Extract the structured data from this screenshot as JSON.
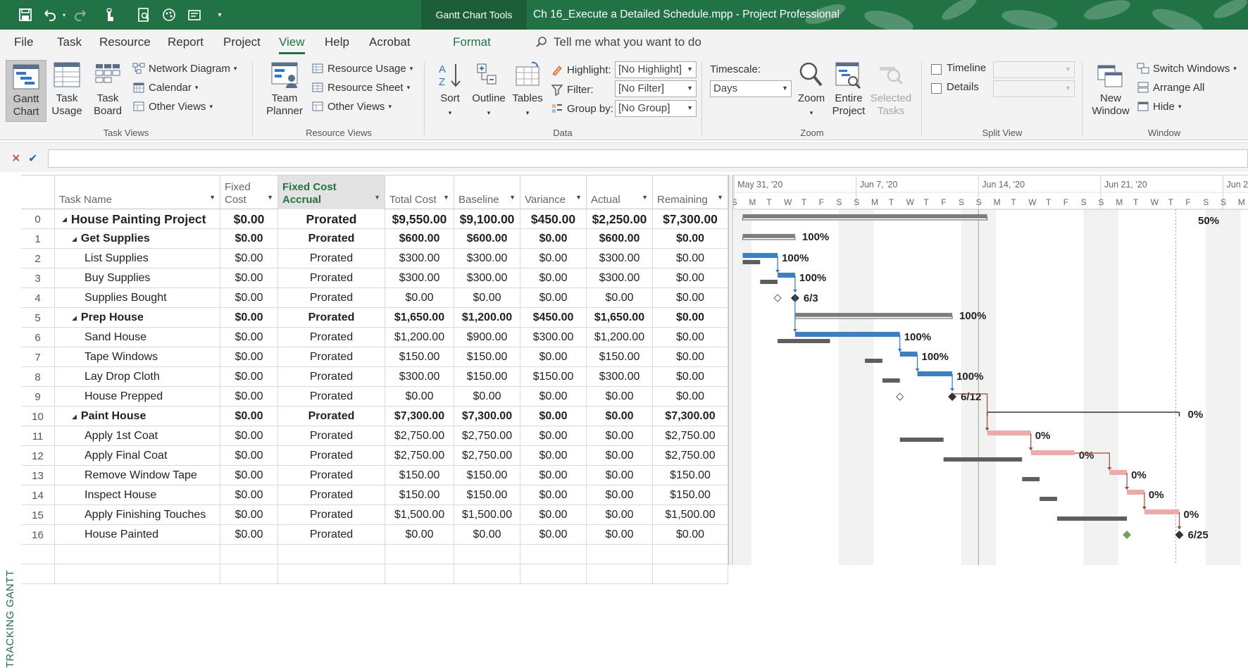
{
  "app": {
    "document_title": "Ch 16_Execute a Detailed Schedule.mpp  -  Project Professional",
    "contextual_tab_group": "Gantt Chart Tools"
  },
  "quick_access_icons": [
    "save-icon",
    "undo-icon",
    "redo-icon",
    "touch-mode-icon",
    "print-preview-icon",
    "format-painter-icon",
    "more-commands-icon",
    "customize-icon"
  ],
  "menu": {
    "items": [
      "File",
      "Task",
      "Resource",
      "Report",
      "Project",
      "View",
      "Help",
      "Acrobat"
    ],
    "active": "View",
    "format": "Format",
    "tell_me": "Tell me what you want to do"
  },
  "ribbon": {
    "task_views": {
      "group": "Task Views",
      "gantt_chart": "Gantt Chart",
      "task_usage": "Task Usage",
      "task_board": "Task Board",
      "network_diagram": "Network Diagram",
      "calendar": "Calendar",
      "other_views": "Other Views"
    },
    "resource_views": {
      "group": "Resource Views",
      "team_planner": "Team Planner",
      "resource_usage": "Resource Usage",
      "resource_sheet": "Resource Sheet",
      "other_views": "Other Views"
    },
    "data": {
      "group": "Data",
      "sort": "Sort",
      "outline": "Outline",
      "tables": "Tables",
      "highlight_label": "Highlight:",
      "highlight_value": "[No Highlight]",
      "filter_label": "Filter:",
      "filter_value": "[No Filter]",
      "group_by_label": "Group by:",
      "group_by_value": "[No Group]"
    },
    "zoom": {
      "group": "Zoom",
      "timescale_label": "Timescale:",
      "timescale_value": "Days",
      "zoom": "Zoom",
      "entire_project": "Entire Project",
      "selected_tasks": "Selected Tasks"
    },
    "split_view": {
      "group": "Split View",
      "timeline": "Timeline",
      "details": "Details"
    },
    "window": {
      "group": "Window",
      "new_window": "New Window",
      "switch_windows": "Switch Windows",
      "arrange_all": "Arrange All",
      "hide": "Hide"
    }
  },
  "view_label": "TRACKING GANTT",
  "table": {
    "columns": [
      "Task Name",
      "Fixed Cost",
      "Fixed Cost Accrual",
      "Total Cost",
      "Baseline",
      "Variance",
      "Actual",
      "Remaining"
    ],
    "rows": [
      {
        "id": "0",
        "name": "House Painting Project",
        "fixed": "$0.00",
        "accrual": "Prorated",
        "total": "$9,550.00",
        "baseline": "$9,100.00",
        "variance": "$450.00",
        "actual": "$2,250.00",
        "remaining": "$7,300.00"
      },
      {
        "id": "1",
        "name": "Get Supplies",
        "fixed": "$0.00",
        "accrual": "Prorated",
        "total": "$600.00",
        "baseline": "$600.00",
        "variance": "$0.00",
        "actual": "$600.00",
        "remaining": "$0.00"
      },
      {
        "id": "2",
        "name": "List Supplies",
        "fixed": "$0.00",
        "accrual": "Prorated",
        "total": "$300.00",
        "baseline": "$300.00",
        "variance": "$0.00",
        "actual": "$300.00",
        "remaining": "$0.00"
      },
      {
        "id": "3",
        "name": "Buy Supplies",
        "fixed": "$0.00",
        "accrual": "Prorated",
        "total": "$300.00",
        "baseline": "$300.00",
        "variance": "$0.00",
        "actual": "$300.00",
        "remaining": "$0.00"
      },
      {
        "id": "4",
        "name": "Supplies Bought",
        "fixed": "$0.00",
        "accrual": "Prorated",
        "total": "$0.00",
        "baseline": "$0.00",
        "variance": "$0.00",
        "actual": "$0.00",
        "remaining": "$0.00"
      },
      {
        "id": "5",
        "name": "Prep House",
        "fixed": "$0.00",
        "accrual": "Prorated",
        "total": "$1,650.00",
        "baseline": "$1,200.00",
        "variance": "$450.00",
        "actual": "$1,650.00",
        "remaining": "$0.00"
      },
      {
        "id": "6",
        "name": "Sand House",
        "fixed": "$0.00",
        "accrual": "Prorated",
        "total": "$1,200.00",
        "baseline": "$900.00",
        "variance": "$300.00",
        "actual": "$1,200.00",
        "remaining": "$0.00"
      },
      {
        "id": "7",
        "name": "Tape Windows",
        "fixed": "$0.00",
        "accrual": "Prorated",
        "total": "$150.00",
        "baseline": "$150.00",
        "variance": "$0.00",
        "actual": "$150.00",
        "remaining": "$0.00"
      },
      {
        "id": "8",
        "name": "Lay Drop Cloth",
        "fixed": "$0.00",
        "accrual": "Prorated",
        "total": "$300.00",
        "baseline": "$150.00",
        "variance": "$150.00",
        "actual": "$300.00",
        "remaining": "$0.00"
      },
      {
        "id": "9",
        "name": "House Prepped",
        "fixed": "$0.00",
        "accrual": "Prorated",
        "total": "$0.00",
        "baseline": "$0.00",
        "variance": "$0.00",
        "actual": "$0.00",
        "remaining": "$0.00"
      },
      {
        "id": "10",
        "name": "Paint House",
        "fixed": "$0.00",
        "accrual": "Prorated",
        "total": "$7,300.00",
        "baseline": "$7,300.00",
        "variance": "$0.00",
        "actual": "$0.00",
        "remaining": "$7,300.00"
      },
      {
        "id": "11",
        "name": "Apply 1st Coat",
        "fixed": "$0.00",
        "accrual": "Prorated",
        "total": "$2,750.00",
        "baseline": "$2,750.00",
        "variance": "$0.00",
        "actual": "$0.00",
        "remaining": "$2,750.00"
      },
      {
        "id": "12",
        "name": "Apply Final Coat",
        "fixed": "$0.00",
        "accrual": "Prorated",
        "total": "$2,750.00",
        "baseline": "$2,750.00",
        "variance": "$0.00",
        "actual": "$0.00",
        "remaining": "$2,750.00"
      },
      {
        "id": "13",
        "name": "Remove Window Tape",
        "fixed": "$0.00",
        "accrual": "Prorated",
        "total": "$150.00",
        "baseline": "$150.00",
        "variance": "$0.00",
        "actual": "$0.00",
        "remaining": "$150.00"
      },
      {
        "id": "14",
        "name": "Inspect House",
        "fixed": "$0.00",
        "accrual": "Prorated",
        "total": "$150.00",
        "baseline": "$150.00",
        "variance": "$0.00",
        "actual": "$0.00",
        "remaining": "$150.00"
      },
      {
        "id": "15",
        "name": "Apply Finishing Touches",
        "fixed": "$0.00",
        "accrual": "Prorated",
        "total": "$1,500.00",
        "baseline": "$1,500.00",
        "variance": "$0.00",
        "actual": "$0.00",
        "remaining": "$1,500.00"
      },
      {
        "id": "16",
        "name": "House Painted",
        "fixed": "$0.00",
        "accrual": "Prorated",
        "total": "$0.00",
        "baseline": "$0.00",
        "variance": "$0.00",
        "actual": "$0.00",
        "remaining": "$0.00"
      }
    ]
  },
  "timescale": {
    "weeks": [
      "May 31, '20",
      "Jun 7, '20",
      "Jun 14, '20",
      "Jun 21, '20",
      "Jun 2"
    ],
    "day_letters": [
      "S",
      "M",
      "T",
      "W",
      "T",
      "F",
      "S"
    ]
  },
  "gantt_tasks": [
    {
      "type": "summary",
      "tracked": true,
      "start": 0,
      "finish": 14,
      "pct": "50%"
    },
    {
      "type": "summary",
      "tracked": true,
      "start": 0,
      "finish": 3,
      "pct": "100%"
    },
    {
      "type": "task",
      "start": 0,
      "finish": 2,
      "bstart": 0,
      "bfinish": 1,
      "actual": true,
      "pct": "100%"
    },
    {
      "type": "task",
      "start": 2,
      "finish": 3,
      "bstart": 1,
      "bfinish": 2,
      "actual": true,
      "pct": "100%"
    },
    {
      "type": "milestone",
      "at": 3,
      "bat": 2,
      "actual": true,
      "label": "6/3"
    },
    {
      "type": "summary",
      "tracked": true,
      "start": 3,
      "finish": 12,
      "pct": "100%"
    },
    {
      "type": "task",
      "start": 3,
      "finish": 9,
      "bstart": 2,
      "bfinish": 5,
      "actual": true,
      "pct": "100%"
    },
    {
      "type": "task",
      "start": 9,
      "finish": 10,
      "bstart": 7,
      "bfinish": 8,
      "actual": true,
      "pct": "100%"
    },
    {
      "type": "task",
      "start": 10,
      "finish": 12,
      "bstart": 8,
      "bfinish": 9,
      "actual": true,
      "pct": "100%"
    },
    {
      "type": "milestone",
      "at": 12,
      "bat": 9,
      "actual": true,
      "label": "6/12"
    },
    {
      "type": "summary",
      "tracked": false,
      "start": 14,
      "finish": 25,
      "pct": "0%"
    },
    {
      "type": "task",
      "start": 14,
      "finish": 16.5,
      "bstart": 9,
      "bfinish": 11.5,
      "actual": false,
      "pct": "0%"
    },
    {
      "type": "task",
      "start": 16.5,
      "finish": 19,
      "bstart": 11.5,
      "bfinish": 16,
      "actual": false,
      "pct": "0%"
    },
    {
      "type": "task",
      "start": 21,
      "finish": 22,
      "bstart": 16,
      "bfinish": 17,
      "actual": false,
      "pct": "0%"
    },
    {
      "type": "task",
      "start": 22,
      "finish": 23,
      "bstart": 17,
      "bfinish": 18,
      "actual": false,
      "pct": "0%"
    },
    {
      "type": "task",
      "start": 23,
      "finish": 25,
      "bstart": 18,
      "bfinish": 22,
      "actual": false,
      "pct": "0%"
    },
    {
      "type": "milestone",
      "at": 25,
      "bat": 22,
      "actual": false,
      "label": "6/25"
    }
  ],
  "colors": {
    "brand": "#217346",
    "actual_bar": "#3c7fc9",
    "planned_bar": "#f0a8a8",
    "baseline_bar": "#5e5e5e",
    "summary_bar": "#7f7f7f",
    "link_complete": "#2e75d6",
    "link_pending": "#9c4a2c",
    "status_date": "#8fb28f",
    "deadline": "#6aa84f"
  }
}
